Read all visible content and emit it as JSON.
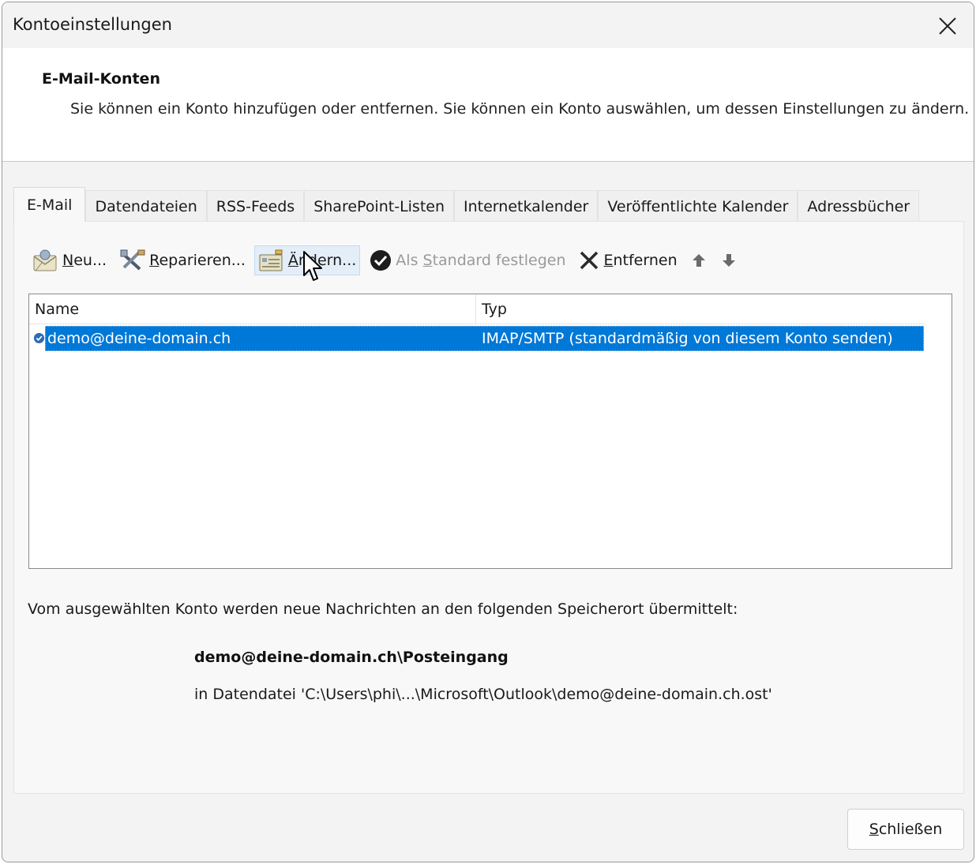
{
  "window": {
    "title": "Kontoeinstellungen"
  },
  "header": {
    "title": "E-Mail-Konten",
    "description": "Sie können ein Konto hinzufügen oder entfernen. Sie können ein Konto auswählen, um dessen Einstellungen zu ändern."
  },
  "tabs": [
    {
      "label": "E-Mail",
      "active": true
    },
    {
      "label": "Datendateien",
      "active": false
    },
    {
      "label": "RSS-Feeds",
      "active": false
    },
    {
      "label": "SharePoint-Listen",
      "active": false
    },
    {
      "label": "Internetkalender",
      "active": false
    },
    {
      "label": "Veröffentlichte Kalender",
      "active": false
    },
    {
      "label": "Adressbücher",
      "active": false
    }
  ],
  "toolbar": {
    "new": {
      "accel": "N",
      "rest": "eu...",
      "icon": "new-account-icon"
    },
    "repair": {
      "accel": "R",
      "rest": "eparieren...",
      "icon": "repair-tools-icon"
    },
    "change": {
      "accel": "Ä",
      "rest": "ndern...",
      "icon": "change-account-icon"
    },
    "set_default": {
      "before": "Als ",
      "accel": "S",
      "rest": "tandard festlegen",
      "icon": "checkmark-circle-icon",
      "disabled": true
    },
    "remove": {
      "accel": "E",
      "rest": "ntfernen",
      "icon": "remove-x-icon"
    },
    "move_up_icon": "arrow-up-icon",
    "move_down_icon": "arrow-down-icon"
  },
  "accounts_list": {
    "columns": [
      "Name",
      "Typ"
    ],
    "rows": [
      {
        "name": "demo@deine-domain.ch",
        "type": "IMAP/SMTP (standardmäßig von diesem Konto senden)",
        "selected": true,
        "default": true
      }
    ]
  },
  "delivery": {
    "info": "Vom ausgewählten Konto werden neue Nachrichten an den folgenden Speicherort übermittelt:",
    "folder": "demo@deine-domain.ch\\Posteingang",
    "datafile": "in Datendatei 'C:\\Users\\phi\\...\\Microsoft\\Outlook\\demo@deine-domain.ch.ost'"
  },
  "footer": {
    "close_accel": "S",
    "close_rest": "chließen"
  },
  "colors": {
    "selection": "#0078d7",
    "dialog_bg": "#f3f3f3",
    "panel_bg": "#f8f8f8"
  }
}
